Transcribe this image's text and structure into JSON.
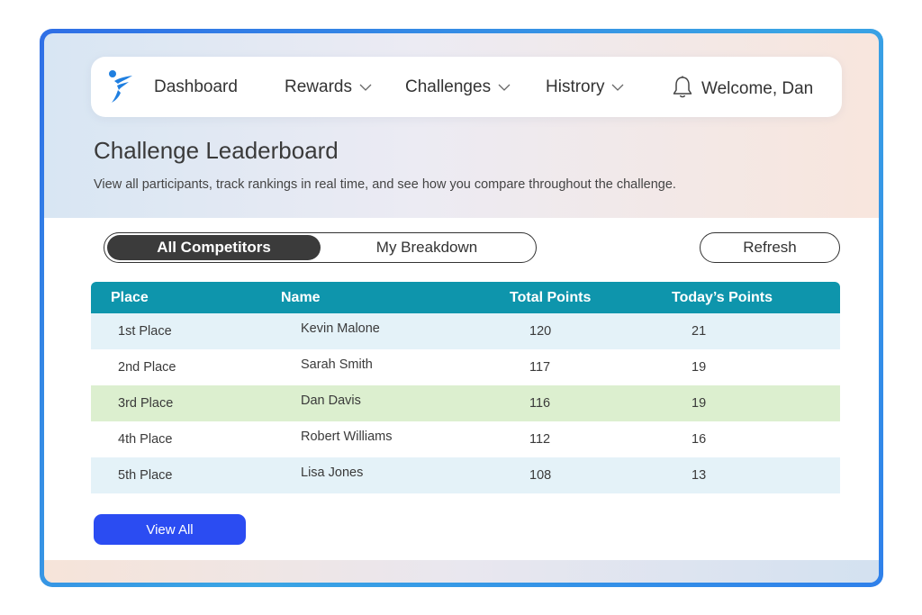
{
  "nav": {
    "items": [
      {
        "label": "Dashboard"
      },
      {
        "label": "Rewards"
      },
      {
        "label": "Challenges"
      },
      {
        "label": "Histrory"
      }
    ],
    "welcome": "Welcome, Dan"
  },
  "header": {
    "title": "Challenge Leaderboard",
    "subtitle": "View all participants, track rankings in real time, and see how you compare throughout the challenge."
  },
  "toggle": {
    "active_label": "All Competitors",
    "inactive_label": "My Breakdown"
  },
  "refresh_label": "Refresh",
  "table": {
    "headers": [
      "Place",
      "Name",
      "Total Points",
      "Today’s Points"
    ],
    "rows": [
      {
        "place": "1st Place",
        "name": "Kevin Malone",
        "total": "120",
        "today": "21",
        "highlight": "#e4f2f8"
      },
      {
        "place": "2nd Place",
        "name": "Sarah Smith",
        "total": "117",
        "today": "19",
        "highlight": "#ffffff"
      },
      {
        "place": "3rd Place",
        "name": "Dan Davis",
        "total": "116",
        "today": "19",
        "highlight": "#dcefcf"
      },
      {
        "place": "4th Place",
        "name": "Robert Williams",
        "total": "112",
        "today": "16",
        "highlight": "#ffffff"
      },
      {
        "place": "5th Place",
        "name": "Lisa Jones",
        "total": "108",
        "today": "13",
        "highlight": "#e4f2f8"
      }
    ]
  },
  "view_all_label": "View All",
  "colors": {
    "header_teal": "#0e95ac",
    "primary_blue": "#2b4cf2",
    "current_user_row": "#dcefcf"
  },
  "icons": {
    "logo": "brand-logo",
    "chevron": "chevron-down-icon",
    "bell": "bell-icon"
  }
}
